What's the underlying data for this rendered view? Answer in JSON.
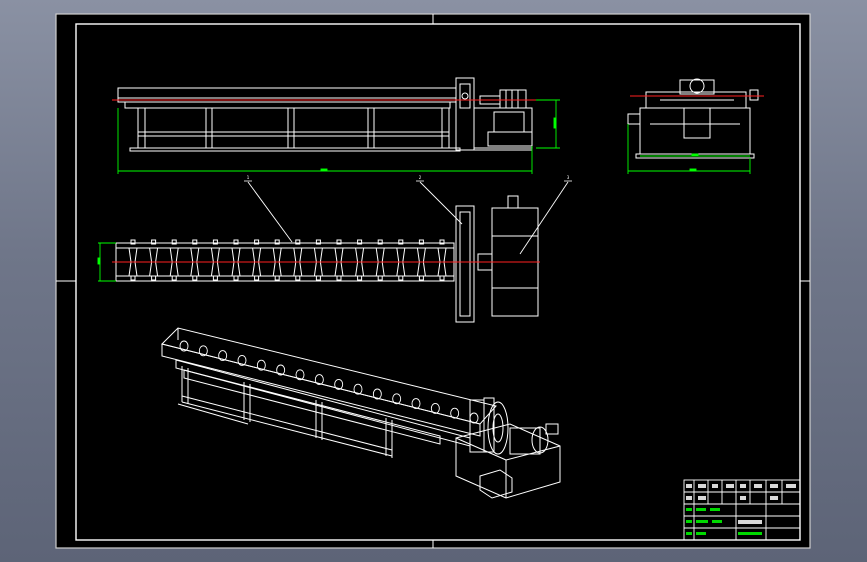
{
  "drawing": {
    "background_color": "#000000",
    "line_color": "#ffffff",
    "dimension_color": "#00ff00",
    "centerline_color": "#ff2020",
    "sheet_color": "#6e7587"
  },
  "views": {
    "front": "front-elevation-view",
    "side": "side-elevation-view",
    "top": "top-plan-view",
    "iso": "isometric-view"
  },
  "balloons": [
    "1",
    "2",
    "3"
  ],
  "title_block": {
    "rows": 6,
    "columns": 6
  }
}
